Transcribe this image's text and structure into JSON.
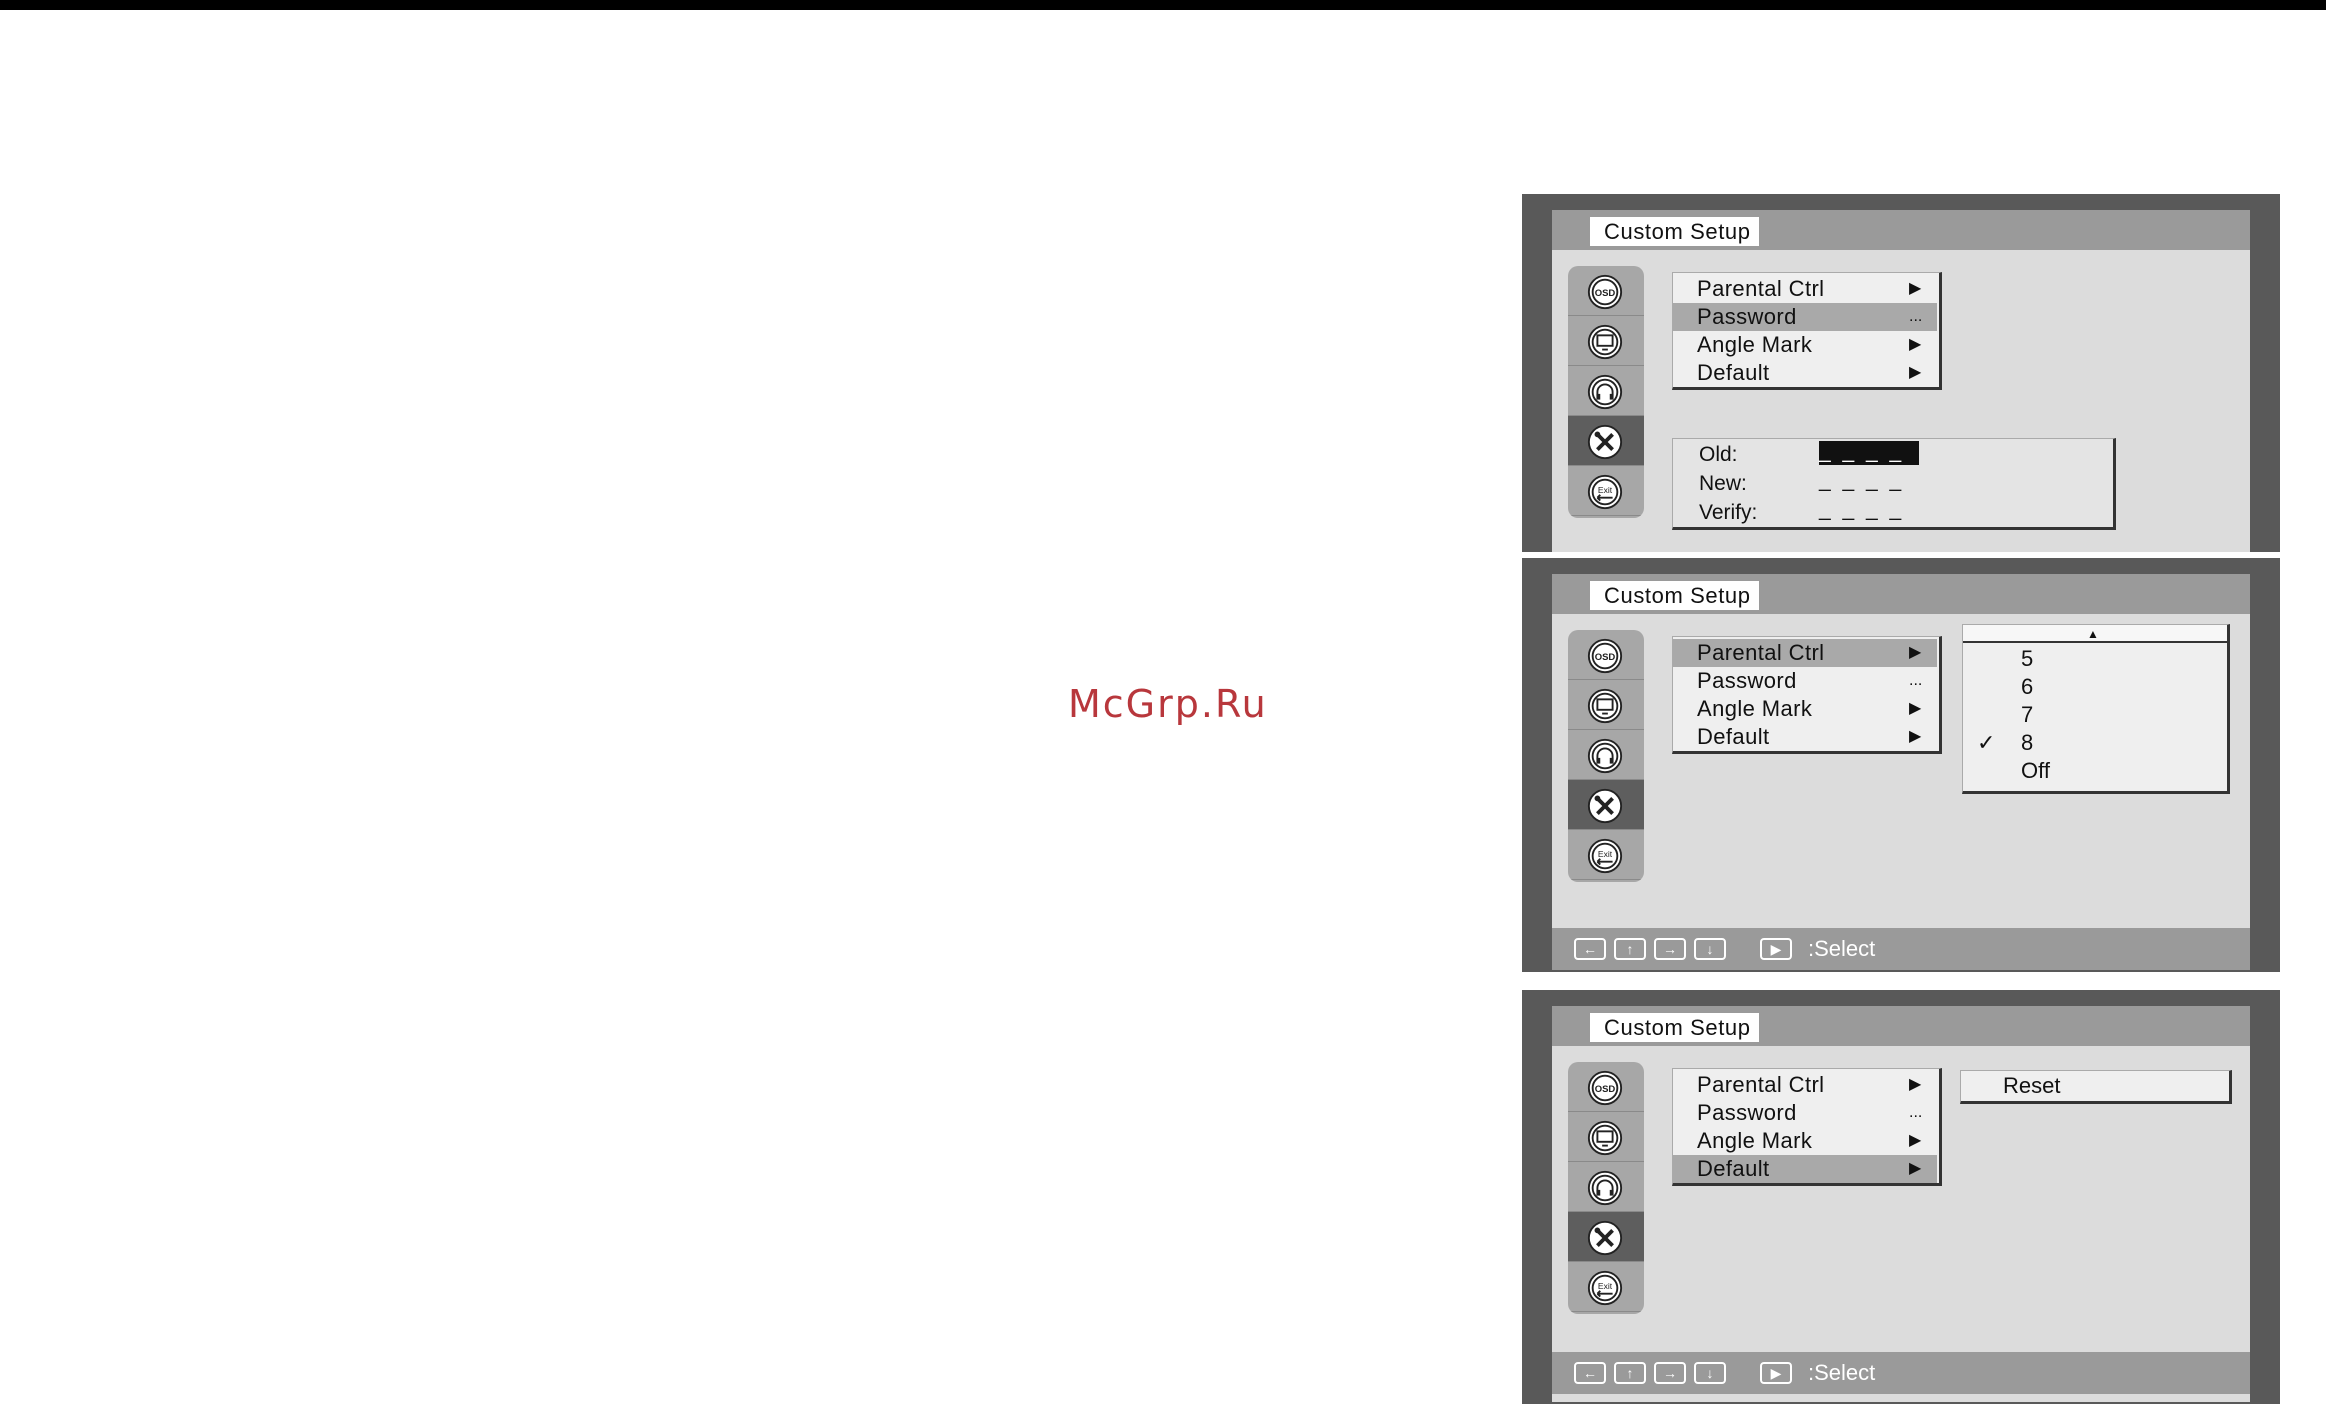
{
  "watermark": "McGrp.Ru",
  "screens": [
    {
      "title": "Custom Setup",
      "menu": [
        {
          "label": "Parental Ctrl",
          "mark": "▶"
        },
        {
          "label": "Password",
          "mark": "..."
        },
        {
          "label": "Angle Mark",
          "mark": "▶"
        },
        {
          "label": "Default",
          "mark": "▶"
        }
      ],
      "selected_menu_item": "Password",
      "password": {
        "old_label": "Old:",
        "old_value": "_ _ _ _",
        "new_label": "New:",
        "new_value": "_ _ _ _",
        "verify_label": "Verify:",
        "verify_value": "_ _ _ _"
      }
    },
    {
      "title": "Custom Setup",
      "menu": [
        {
          "label": "Parental Ctrl",
          "mark": "▶"
        },
        {
          "label": "Password",
          "mark": "..."
        },
        {
          "label": "Angle Mark",
          "mark": "▶"
        },
        {
          "label": "Default",
          "mark": "▶"
        }
      ],
      "selected_menu_item": "Parental Ctrl",
      "list_up_arrow": "▲",
      "level_options": [
        "5",
        "6",
        "7",
        "8",
        "Off"
      ],
      "checked_option": "8",
      "check_mark": "✓",
      "nav": {
        "select_label": ":Select"
      }
    },
    {
      "title": "Custom Setup",
      "menu": [
        {
          "label": "Parental Ctrl",
          "mark": "▶"
        },
        {
          "label": "Password",
          "mark": "..."
        },
        {
          "label": "Angle Mark",
          "mark": "▶"
        },
        {
          "label": "Default",
          "mark": "▶"
        }
      ],
      "selected_menu_item": "Default",
      "default_option": "Reset",
      "nav": {
        "select_label": ":Select"
      }
    }
  ],
  "icons": [
    "osd-icon",
    "display-icon",
    "audio-icon",
    "setup-icon",
    "exit-icon"
  ],
  "icon_texts": {
    "osd": "OSD",
    "exit": "Exit"
  },
  "nav_keys": [
    "←",
    "↑",
    "→",
    "↓",
    "▶"
  ],
  "colors": {
    "frame": "#595959",
    "screen_bg": "#dcdcdc",
    "bar": "#9a9a9a",
    "highlight": "#a9a9a9",
    "watermark": "#b8373c"
  }
}
